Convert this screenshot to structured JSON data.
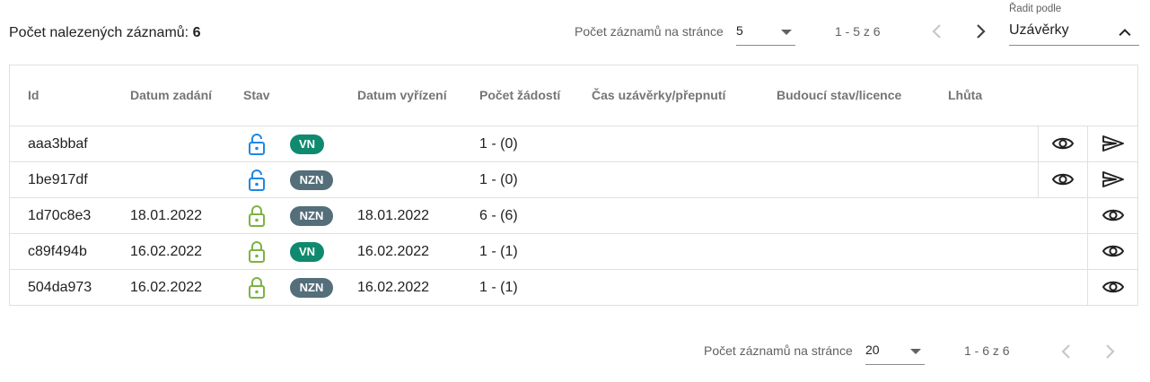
{
  "summary": {
    "label": "Počet nalezených záznamů: ",
    "count": "6"
  },
  "top_pager": {
    "per_page_label": "Počet záznamů na stránce",
    "per_page_value": "5",
    "range": "1 - 5 z 6"
  },
  "sort": {
    "label": "Řadit podle",
    "value": "Uzávěrky"
  },
  "table": {
    "headers": [
      "Id",
      "Datum zadání",
      "Stav",
      "Datum vyřízení",
      "Počet žádostí",
      "Čas uzávěrky/přepnutí",
      "Budoucí stav/licence",
      "Lhůta"
    ],
    "rows": [
      {
        "id": "aaa3bbaf",
        "datum_zadani": "",
        "lock": "open",
        "badge": "VN",
        "datum_vyrizeni": "",
        "pocet": "1 - (0)",
        "actions": [
          "eye",
          "send"
        ]
      },
      {
        "id": "1be917df",
        "datum_zadani": "",
        "lock": "open",
        "badge": "NZN",
        "datum_vyrizeni": "",
        "pocet": "1 - (0)",
        "actions": [
          "eye",
          "send"
        ]
      },
      {
        "id": "1d70c8e3",
        "datum_zadani": "18.01.2022",
        "lock": "closed",
        "badge": "NZN",
        "datum_vyrizeni": "18.01.2022",
        "pocet": "6 - (6)",
        "actions": [
          "eye"
        ]
      },
      {
        "id": "c89f494b",
        "datum_zadani": "16.02.2022",
        "lock": "closed",
        "badge": "VN",
        "datum_vyrizeni": "16.02.2022",
        "pocet": "1 - (1)",
        "actions": [
          "eye"
        ]
      },
      {
        "id": "504da973",
        "datum_zadani": "16.02.2022",
        "lock": "closed",
        "badge": "NZN",
        "datum_vyrizeni": "16.02.2022",
        "pocet": "1 - (1)",
        "actions": [
          "eye"
        ]
      }
    ]
  },
  "bottom_pager": {
    "per_page_label": "Počet záznamů na stránce",
    "per_page_value": "20",
    "range": "1 - 6 z 6"
  },
  "colors": {
    "vn_badge": "#0f8a6e",
    "nzn_badge": "#546e7a",
    "lock_open": "#1e88e5",
    "lock_closed": "#7cb342"
  },
  "icons": {
    "lock_open": "lock-open-icon",
    "lock_closed": "lock-closed-icon",
    "eye": "eye-icon",
    "send": "send-icon",
    "prev": "chevron-left-icon",
    "next": "chevron-right-icon",
    "dropdown": "caret-down-icon",
    "sort": "chevron-up-icon"
  }
}
